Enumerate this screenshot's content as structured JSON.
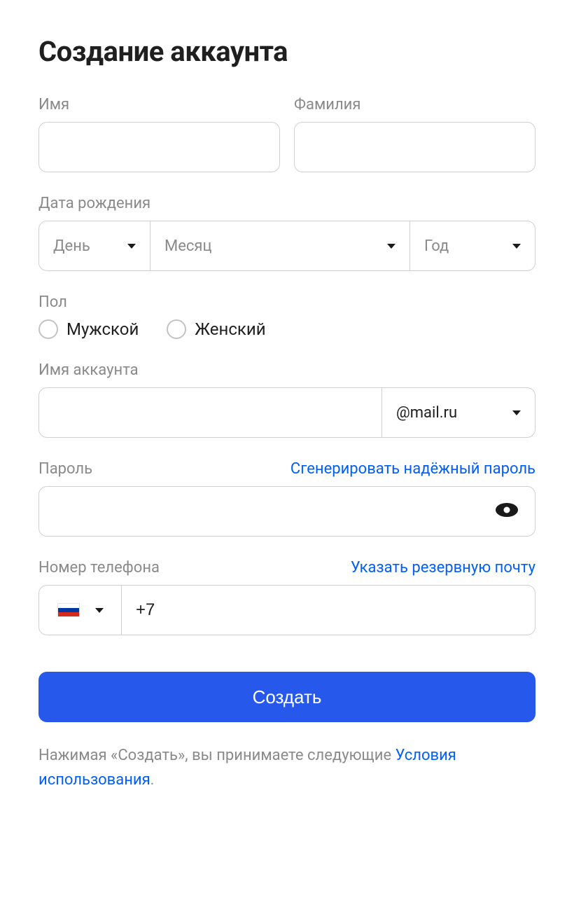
{
  "title": "Создание аккаунта",
  "firstName": {
    "label": "Имя"
  },
  "lastName": {
    "label": "Фамилия"
  },
  "birthdate": {
    "label": "Дата рождения",
    "day": "День",
    "month": "Месяц",
    "year": "Год"
  },
  "gender": {
    "label": "Пол",
    "male": "Мужской",
    "female": "Женский"
  },
  "account": {
    "label": "Имя аккаунта",
    "domain": "@mail.ru"
  },
  "password": {
    "label": "Пароль",
    "generateLink": "Сгенерировать надёжный пароль"
  },
  "phone": {
    "label": "Номер телефона",
    "backupLink": "Указать резервную почту",
    "value": "+7",
    "flagColors": {
      "top": "#ffffff",
      "mid": "#0039a6",
      "bot": "#d52b1e"
    }
  },
  "submit": "Создать",
  "terms": {
    "prefix": "Нажимая «Создать», вы принимаете следующие ",
    "link": "Условия использования",
    "suffix": "."
  }
}
